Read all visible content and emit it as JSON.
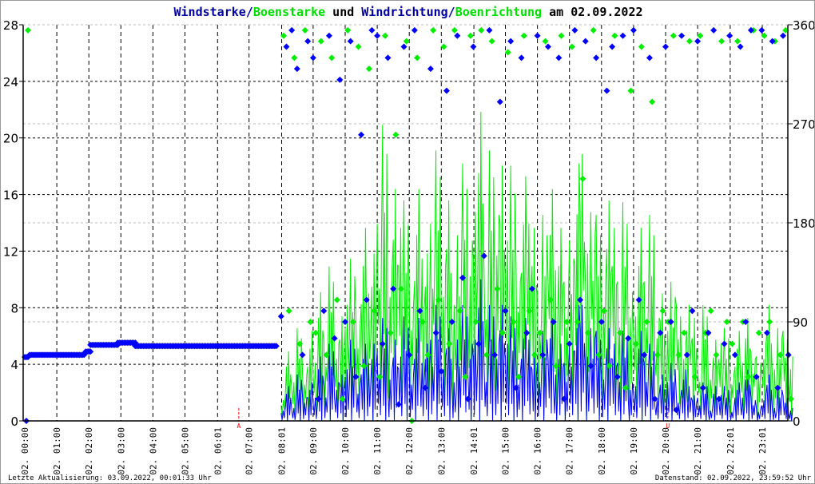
{
  "chart_data": {
    "type": "scatter",
    "title_parts": [
      {
        "text": "Windstarke",
        "color": "#0000a0"
      },
      {
        "text": "/",
        "color": "#0000a0"
      },
      {
        "text": "Boenstarke",
        "color": "#00e000"
      },
      {
        "text": " und ",
        "color": "#000000"
      },
      {
        "text": "Windrichtung",
        "color": "#0000a0"
      },
      {
        "text": "/",
        "color": "#0000a0"
      },
      {
        "text": "Boenrichtung",
        "color": "#00e000"
      },
      {
        "text": " am 02.09.2022",
        "color": "#000000"
      }
    ],
    "y_left": {
      "range": [
        0,
        28
      ],
      "ticks": [
        "0",
        "4",
        "8",
        "12",
        "16",
        "20",
        "24",
        "28"
      ]
    },
    "y_right": {
      "range": [
        0,
        360
      ],
      "ticks": [
        "0",
        "90",
        "180",
        "270",
        "360"
      ]
    },
    "x_range_hours": [
      0,
      24
    ],
    "x_ticks": [
      {
        "h": 0,
        "label": "02. 00:00"
      },
      {
        "h": 1,
        "label": "02. 01:00"
      },
      {
        "h": 2,
        "label": "02. 02:00"
      },
      {
        "h": 3,
        "label": "02. 03:00"
      },
      {
        "h": 4,
        "label": "02. 04:00"
      },
      {
        "h": 5,
        "label": "02. 05:00"
      },
      {
        "h": 6.017,
        "label": "02. 06:01"
      },
      {
        "h": 7,
        "label": "02. 07:00"
      },
      {
        "h": 8.017,
        "label": "02. 08:01"
      },
      {
        "h": 9,
        "label": "02. 09:00"
      },
      {
        "h": 10,
        "label": "02. 10:00"
      },
      {
        "h": 11,
        "label": "02. 11:00"
      },
      {
        "h": 12,
        "label": "02. 12:00"
      },
      {
        "h": 13,
        "label": "02. 13:00"
      },
      {
        "h": 14.017,
        "label": "02. 14:01"
      },
      {
        "h": 15,
        "label": "02. 15:00"
      },
      {
        "h": 16,
        "label": "02. 16:00"
      },
      {
        "h": 17,
        "label": "02. 17:00"
      },
      {
        "h": 18,
        "label": "02. 18:00"
      },
      {
        "h": 19,
        "label": "02. 19:00"
      },
      {
        "h": 20,
        "label": "02. 20:00"
      },
      {
        "h": 21,
        "label": "02. 21:00"
      },
      {
        "h": 22.017,
        "label": "02. 22:01"
      },
      {
        "h": 23.017,
        "label": "02. 23:01"
      }
    ],
    "markers": [
      {
        "h": 6.68,
        "label": "A",
        "color": "#ff0000"
      },
      {
        "h": 20.07,
        "label": "U",
        "color": "#ff0000"
      }
    ],
    "colors": {
      "wind": "#0000ff",
      "gust": "#00ee00",
      "axis": "#000000",
      "grid_dir": "#bbbbbb"
    },
    "night_direction_segments": [
      {
        "from": 0.0,
        "to": 0.1,
        "dir": 58
      },
      {
        "from": 0.15,
        "to": 1.9,
        "dir": 60
      },
      {
        "from": 1.9,
        "to": 2.05,
        "dir": 63
      },
      {
        "from": 2.05,
        "to": 2.9,
        "dir": 69
      },
      {
        "from": 2.9,
        "to": 3.45,
        "dir": 71
      },
      {
        "from": 3.45,
        "to": 7.85,
        "dir": 68
      }
    ],
    "series_start_hour": 8.0,
    "series_step_minutes": 10,
    "series": [
      {
        "name": "Boenstarke",
        "values": [
          2,
          6,
          3,
          8,
          4,
          7,
          5,
          10,
          7,
          12,
          6,
          9,
          9,
          14,
          8,
          15,
          11,
          13,
          17,
          23,
          12,
          20,
          15,
          19,
          10,
          18,
          14,
          13,
          17,
          21,
          12,
          19,
          9,
          16,
          20,
          14,
          18,
          24,
          13,
          21,
          16,
          22,
          14,
          22,
          12,
          19,
          17,
          15,
          11,
          16,
          18,
          13,
          15,
          12,
          14,
          20,
          23,
          13,
          18,
          16,
          11,
          19,
          15,
          12,
          17,
          10,
          9,
          15,
          12,
          16,
          8,
          11,
          7,
          12,
          9,
          6,
          10,
          8,
          5,
          9,
          4,
          7,
          6,
          8,
          4,
          7,
          5,
          8,
          6,
          5,
          6,
          10,
          4,
          8,
          7,
          5
        ]
      },
      {
        "name": "Windstarke",
        "values": [
          1,
          3,
          1,
          4,
          2,
          3,
          2,
          5,
          3,
          6,
          3,
          4,
          4,
          7,
          3,
          6,
          5,
          6,
          6,
          8,
          4,
          7,
          5,
          9,
          4,
          8,
          5,
          6,
          7,
          9,
          5,
          8,
          3,
          7,
          9,
          6,
          7,
          11,
          5,
          9,
          6,
          10,
          6,
          9,
          4,
          8,
          7,
          5,
          5,
          7,
          8,
          4,
          6,
          5,
          6,
          9,
          10,
          5,
          8,
          7,
          4,
          8,
          6,
          5,
          7,
          3,
          3,
          7,
          5,
          6,
          2,
          4,
          3,
          5,
          2,
          4,
          3,
          2,
          2,
          3,
          1,
          3,
          2,
          3,
          1,
          3,
          2,
          4,
          2,
          1,
          2,
          4,
          1,
          3,
          2,
          1
        ]
      },
      {
        "name": "Windrichtung",
        "values": [
          95,
          340,
          355,
          320,
          60,
          345,
          330,
          20,
          100,
          350,
          75,
          310,
          90,
          345,
          40,
          260,
          110,
          355,
          350,
          70,
          330,
          120,
          15,
          340,
          60,
          355,
          100,
          30,
          320,
          80,
          45,
          300,
          90,
          350,
          130,
          20,
          340,
          70,
          150,
          355,
          60,
          290,
          100,
          345,
          30,
          330,
          80,
          120,
          350,
          60,
          340,
          90,
          330,
          20,
          70,
          355,
          110,
          345,
          50,
          330,
          90,
          300,
          340,
          40,
          350,
          75,
          355,
          110,
          60,
          330,
          20,
          80,
          340,
          90,
          10,
          350,
          60,
          100,
          345,
          30,
          80,
          355,
          20,
          70,
          350,
          60,
          340,
          90,
          355,
          40,
          355,
          80,
          345,
          30,
          350,
          60
        ]
      },
      {
        "name": "Boenrichtung",
        "values": [
          350,
          100,
          330,
          70,
          355,
          90,
          80,
          345,
          60,
          330,
          110,
          20,
          355,
          90,
          340,
          50,
          320,
          100,
          40,
          350,
          80,
          260,
          120,
          345,
          0,
          330,
          90,
          60,
          355,
          110,
          340,
          70,
          355,
          100,
          40,
          350,
          90,
          355,
          60,
          345,
          120,
          80,
          335,
          90,
          40,
          350,
          100,
          60,
          80,
          345,
          110,
          50,
          350,
          90,
          340,
          90,
          220,
          80,
          355,
          60,
          100,
          50,
          350,
          80,
          30,
          300,
          70,
          340,
          90,
          290,
          60,
          100,
          90,
          350,
          60,
          80,
          345,
          40,
          350,
          80,
          100,
          60,
          345,
          90,
          70,
          345,
          90,
          40,
          355,
          80,
          350,
          90,
          345,
          60,
          355,
          20
        ]
      }
    ]
  },
  "footer": {
    "left": "Letzte Aktualisierung: 03.09.2022, 00:01:33 Uhr",
    "right": "Datenstand: 02.09.2022, 23:59:52 Uhr"
  }
}
